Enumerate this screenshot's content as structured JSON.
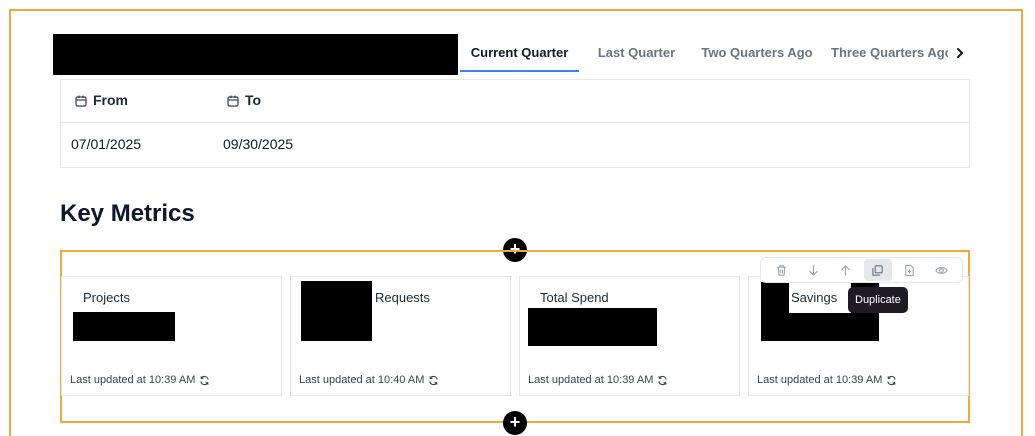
{
  "tabs": [
    {
      "label": "Current Quarter",
      "active": true
    },
    {
      "label": "Last Quarter",
      "active": false
    },
    {
      "label": "Two Quarters Ago",
      "active": false
    },
    {
      "label": "Three Quarters Ago",
      "active": false
    }
  ],
  "tabs_scroll_icon": "chevron-right-icon",
  "date_range": {
    "from_label": "From",
    "to_label": "To",
    "from_value": "07/01/2025",
    "to_value": "09/30/2025"
  },
  "section_title": "Key Metrics",
  "add_label": "+",
  "metrics": [
    {
      "label": "Projects",
      "updated": "Last updated at 10:39 AM"
    },
    {
      "label": "Requests",
      "updated": "Last updated at 10:40 AM"
    },
    {
      "label": "Total Spend",
      "updated": "Last updated at 10:39 AM"
    },
    {
      "label": "Savings",
      "updated": "Last updated at 10:39 AM"
    }
  ],
  "toolbar": {
    "actions": [
      "delete-icon",
      "move-down-icon",
      "move-up-icon",
      "duplicate-icon",
      "export-icon",
      "preview-icon"
    ],
    "tooltip": "Duplicate"
  },
  "colors": {
    "accent": "#3b82f6",
    "highlight_border": "#f0a93a",
    "tooltip_bg": "#1f1b24"
  }
}
